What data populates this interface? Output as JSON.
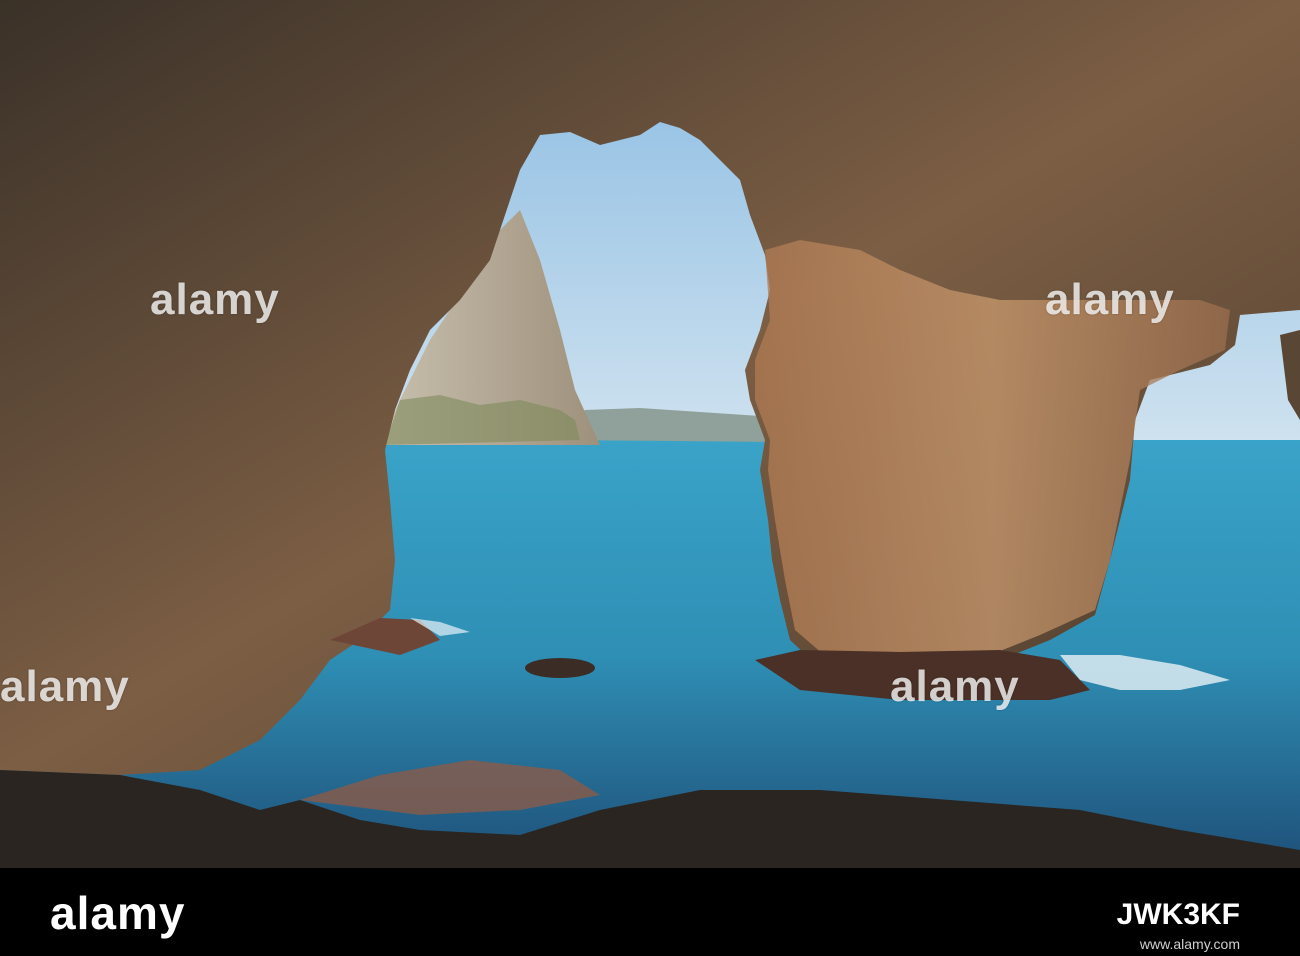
{
  "watermark": {
    "text": "alamy"
  },
  "footer": {
    "logo": "alamy",
    "image_id": "JWK3KF",
    "url": "www.alamy.com"
  },
  "colors": {
    "sky": "#a9cbe6",
    "sea": "#2f8fb5",
    "rock": "#8a6a4c",
    "footer_bg": "#000000"
  }
}
